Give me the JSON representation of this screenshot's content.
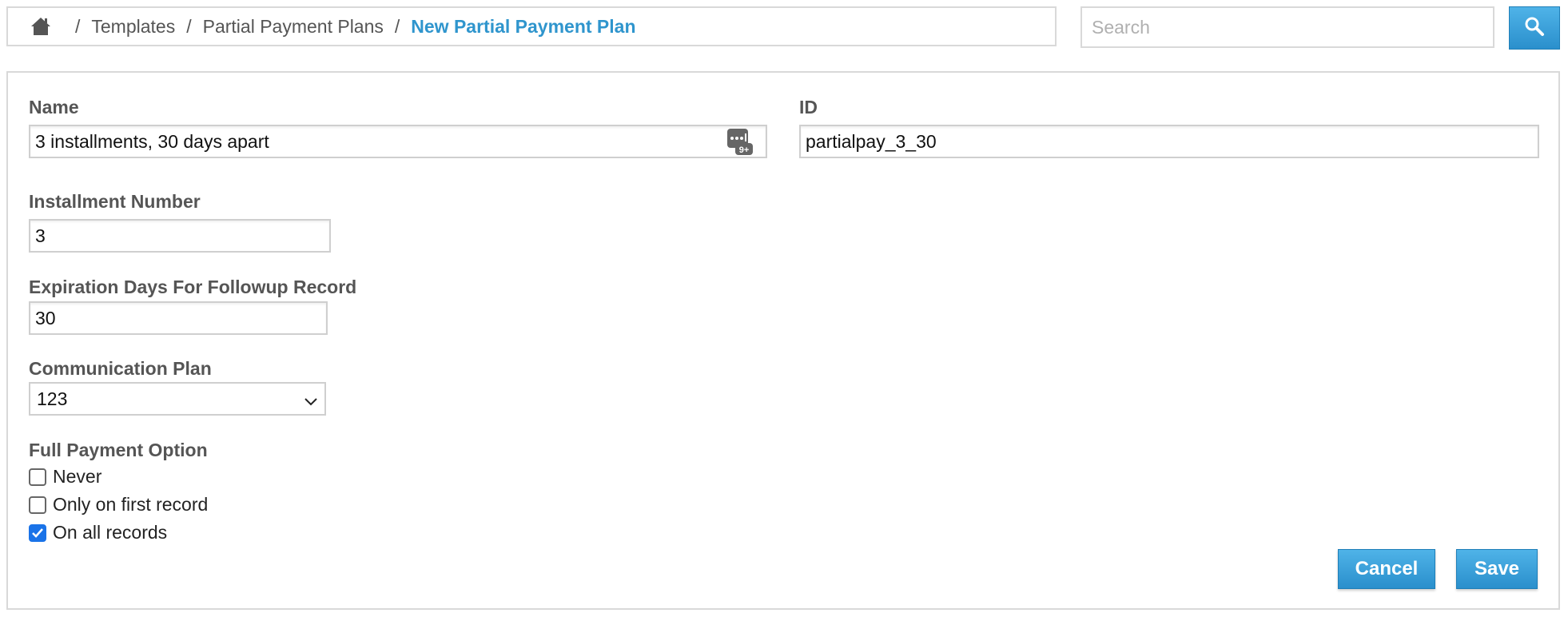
{
  "breadcrumb": {
    "home_icon": "home-icon",
    "items": [
      "Templates",
      "Partial Payment Plans"
    ],
    "current": "New Partial Payment Plan",
    "separator": "/"
  },
  "search": {
    "placeholder": "Search",
    "button_icon": "search-icon"
  },
  "form": {
    "name": {
      "label": "Name",
      "value": "3 installments, 30 days apart",
      "icon": "placeholder-insert-icon"
    },
    "id": {
      "label": "ID",
      "value": "partialpay_3_30"
    },
    "installment_number": {
      "label": "Installment Number",
      "value": "3"
    },
    "expiration_days": {
      "label": "Expiration Days For Followup Record",
      "value": "30"
    },
    "communication_plan": {
      "label": "Communication Plan",
      "selected": "123"
    },
    "full_payment_option": {
      "label": "Full Payment Option",
      "options": [
        {
          "label": "Never",
          "checked": false
        },
        {
          "label": "Only on first record",
          "checked": false
        },
        {
          "label": "On all records",
          "checked": true
        }
      ]
    }
  },
  "actions": {
    "cancel_label": "Cancel",
    "save_label": "Save"
  },
  "colors": {
    "accent": "#2f95cd",
    "button_top": "#4fb3e8",
    "button_bottom": "#2a8fcc",
    "label": "#555555",
    "border": "#d9d9d9",
    "checkbox_checked": "#1a73e8"
  }
}
